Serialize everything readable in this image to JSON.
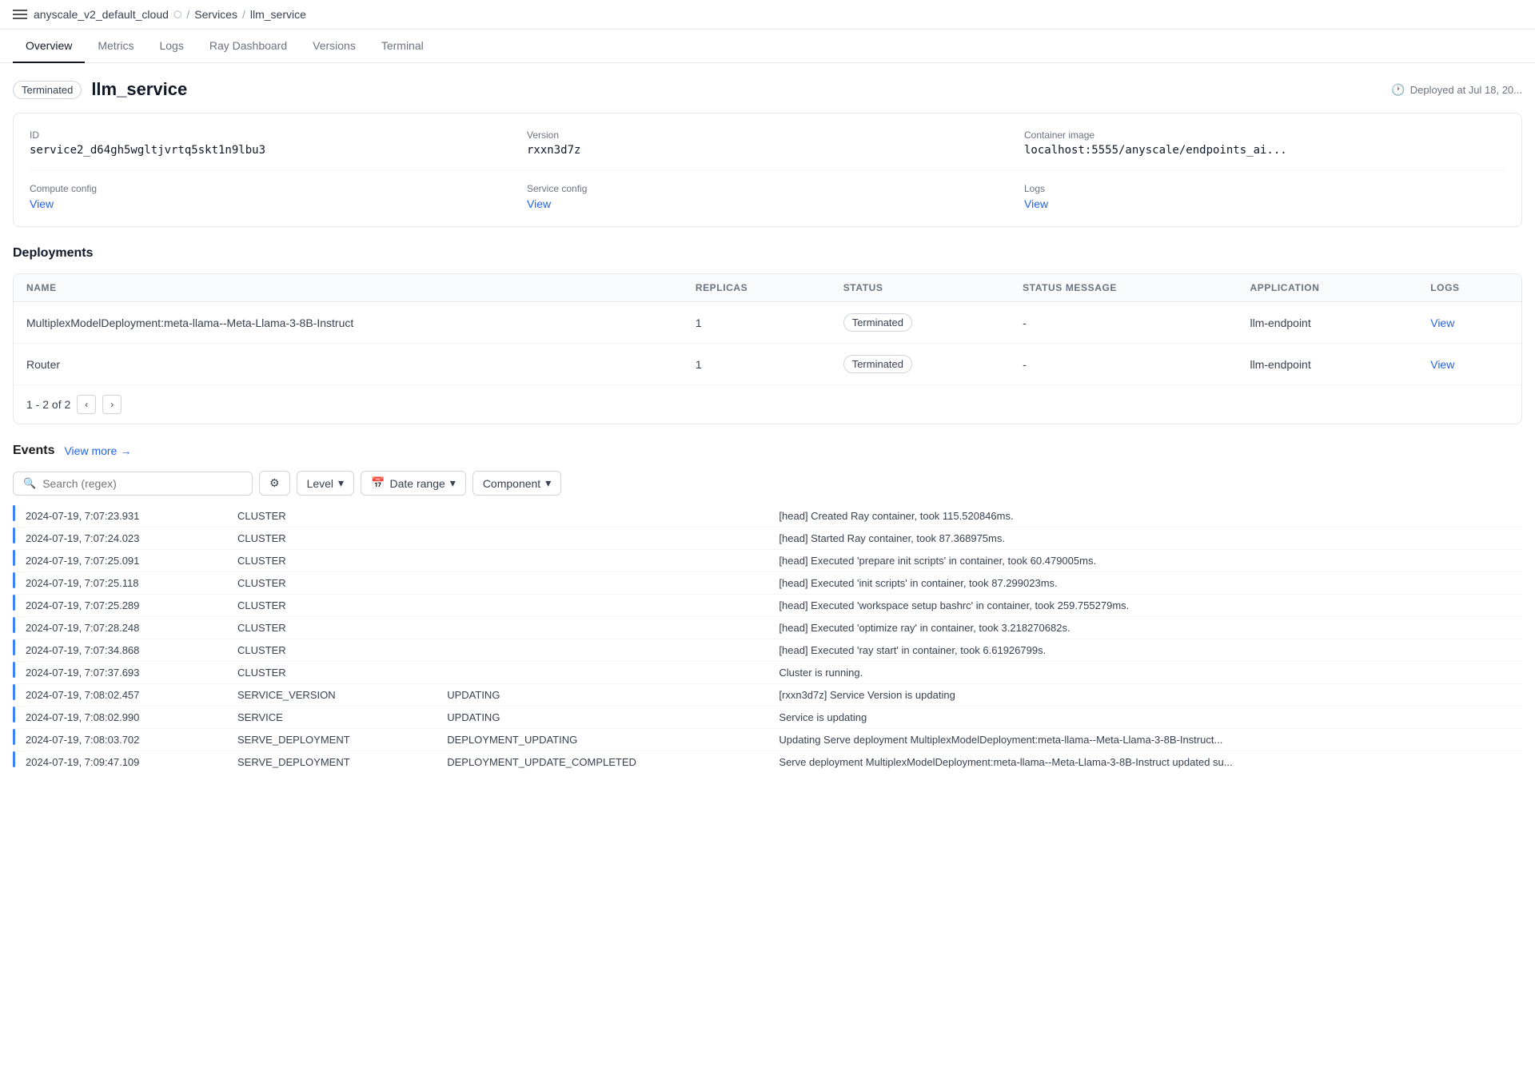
{
  "header": {
    "hamburger_label": "menu",
    "breadcrumb": {
      "cloud": "anyscale_v2_default_cloud",
      "services": "Services",
      "current": "llm_service"
    }
  },
  "tabs": [
    {
      "label": "Overview",
      "active": true
    },
    {
      "label": "Metrics",
      "active": false
    },
    {
      "label": "Logs",
      "active": false
    },
    {
      "label": "Ray Dashboard",
      "active": false
    },
    {
      "label": "Versions",
      "active": false
    },
    {
      "label": "Terminal",
      "active": false
    }
  ],
  "service": {
    "status": "Terminated",
    "name": "llm_service",
    "deployed_at": "Deployed at Jul 18, 20..."
  },
  "info": {
    "id_label": "ID",
    "id_value": "service2_d64gh5wgltjvrtq5skt1n9lbu3",
    "version_label": "Version",
    "version_value": "rxxn3d7z",
    "container_label": "Container image",
    "container_value": "localhost:5555/anyscale/endpoints_ai...",
    "compute_label": "Compute config",
    "compute_link": "View",
    "service_config_label": "Service config",
    "service_config_link": "View",
    "logs_label": "Logs",
    "logs_link": "View"
  },
  "deployments": {
    "title": "Deployments",
    "columns": [
      "NAME",
      "REPLICAS",
      "STATUS",
      "STATUS MESSAGE",
      "APPLICATION",
      "LOGS"
    ],
    "rows": [
      {
        "name": "MultiplexModelDeployment:meta-llama--Meta-Llama-3-8B-Instruct",
        "replicas": "1",
        "status": "Terminated",
        "status_message": "-",
        "application": "llm-endpoint",
        "logs_link": "View"
      },
      {
        "name": "Router",
        "replicas": "1",
        "status": "Terminated",
        "status_message": "-",
        "application": "llm-endpoint",
        "logs_link": "View"
      }
    ],
    "pagination": "1 - 2 of 2"
  },
  "events": {
    "title": "Events",
    "view_more": "View more",
    "search_placeholder": "Search (regex)",
    "filters": [
      "Level",
      "Date range",
      "Component"
    ],
    "rows": [
      {
        "time": "2024-07-19, 7:07:23.931",
        "component": "CLUSTER",
        "action": "",
        "message": "[head] Created Ray container, took 115.520846ms."
      },
      {
        "time": "2024-07-19, 7:07:24.023",
        "component": "CLUSTER",
        "action": "",
        "message": "[head] Started Ray container, took 87.368975ms."
      },
      {
        "time": "2024-07-19, 7:07:25.091",
        "component": "CLUSTER",
        "action": "",
        "message": "[head] Executed 'prepare init scripts' in container, took 60.479005ms."
      },
      {
        "time": "2024-07-19, 7:07:25.118",
        "component": "CLUSTER",
        "action": "",
        "message": "[head] Executed 'init scripts' in container, took 87.299023ms."
      },
      {
        "time": "2024-07-19, 7:07:25.289",
        "component": "CLUSTER",
        "action": "",
        "message": "[head] Executed 'workspace setup bashrc' in container, took 259.755279ms."
      },
      {
        "time": "2024-07-19, 7:07:28.248",
        "component": "CLUSTER",
        "action": "",
        "message": "[head] Executed 'optimize ray' in container, took 3.218270682s."
      },
      {
        "time": "2024-07-19, 7:07:34.868",
        "component": "CLUSTER",
        "action": "",
        "message": "[head] Executed 'ray start' in container, took 6.61926799s."
      },
      {
        "time": "2024-07-19, 7:07:37.693",
        "component": "CLUSTER",
        "action": "",
        "message": "Cluster is running."
      },
      {
        "time": "2024-07-19, 7:08:02.457",
        "component": "SERVICE_VERSION",
        "action": "UPDATING",
        "message": "[rxxn3d7z] Service Version is updating"
      },
      {
        "time": "2024-07-19, 7:08:02.990",
        "component": "SERVICE",
        "action": "UPDATING",
        "message": "Service is updating"
      },
      {
        "time": "2024-07-19, 7:08:03.702",
        "component": "SERVE_DEPLOYMENT",
        "action": "DEPLOYMENT_UPDATING",
        "message": "Updating Serve deployment MultiplexModelDeployment:meta-llama--Meta-Llama-3-8B-Instruct..."
      },
      {
        "time": "2024-07-19, 7:09:47.109",
        "component": "SERVE_DEPLOYMENT",
        "action": "DEPLOYMENT_UPDATE_COMPLETED",
        "message": "Serve deployment MultiplexModelDeployment:meta-llama--Meta-Llama-3-8B-Instruct updated su..."
      }
    ]
  }
}
